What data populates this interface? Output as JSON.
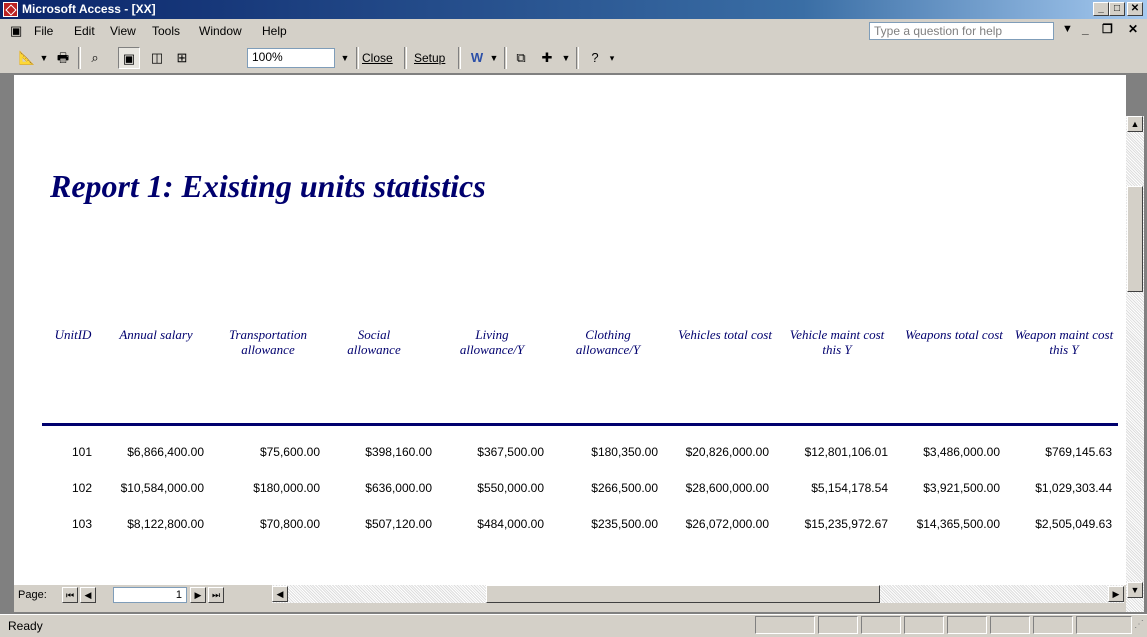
{
  "window": {
    "title": "Microsoft Access - [XX]"
  },
  "menu": {
    "items": [
      "File",
      "Edit",
      "View",
      "Tools",
      "Window",
      "Help"
    ],
    "help_placeholder": "Type a question for help"
  },
  "toolbar": {
    "zoom": "100%",
    "close_label": "Close",
    "setup_label": "Setup"
  },
  "report": {
    "title": "Report 1: Existing units statistics",
    "headers": [
      "UnitID",
      "Annual salary",
      "Transportation allowance",
      "Social allowance",
      "Living allowance/Y",
      "Clothing allowance/Y",
      "Vehicles total cost",
      "Vehicle maint cost this Y",
      "Weapons total cost",
      "Weapon maint cost this Y"
    ],
    "rows": [
      [
        "101",
        "$6,866,400.00",
        "$75,600.00",
        "$398,160.00",
        "$367,500.00",
        "$180,350.00",
        "$20,826,000.00",
        "$12,801,106.01",
        "$3,486,000.00",
        "$769,145.63"
      ],
      [
        "102",
        "$10,584,000.00",
        "$180,000.00",
        "$636,000.00",
        "$550,000.00",
        "$266,500.00",
        "$28,600,000.00",
        "$5,154,178.54",
        "$3,921,500.00",
        "$1,029,303.44"
      ],
      [
        "103",
        "$8,122,800.00",
        "$70,800.00",
        "$507,120.00",
        "$484,000.00",
        "$235,500.00",
        "$26,072,000.00",
        "$15,235,972.67",
        "$14,365,500.00",
        "$2,505,049.63"
      ]
    ]
  },
  "navigation": {
    "page_label": "Page:",
    "page_number": "1"
  },
  "status": {
    "text": "Ready"
  },
  "colors": {
    "title_bar": "#0a246a",
    "report_text": "#00006e",
    "chrome": "#d4d0c8"
  }
}
